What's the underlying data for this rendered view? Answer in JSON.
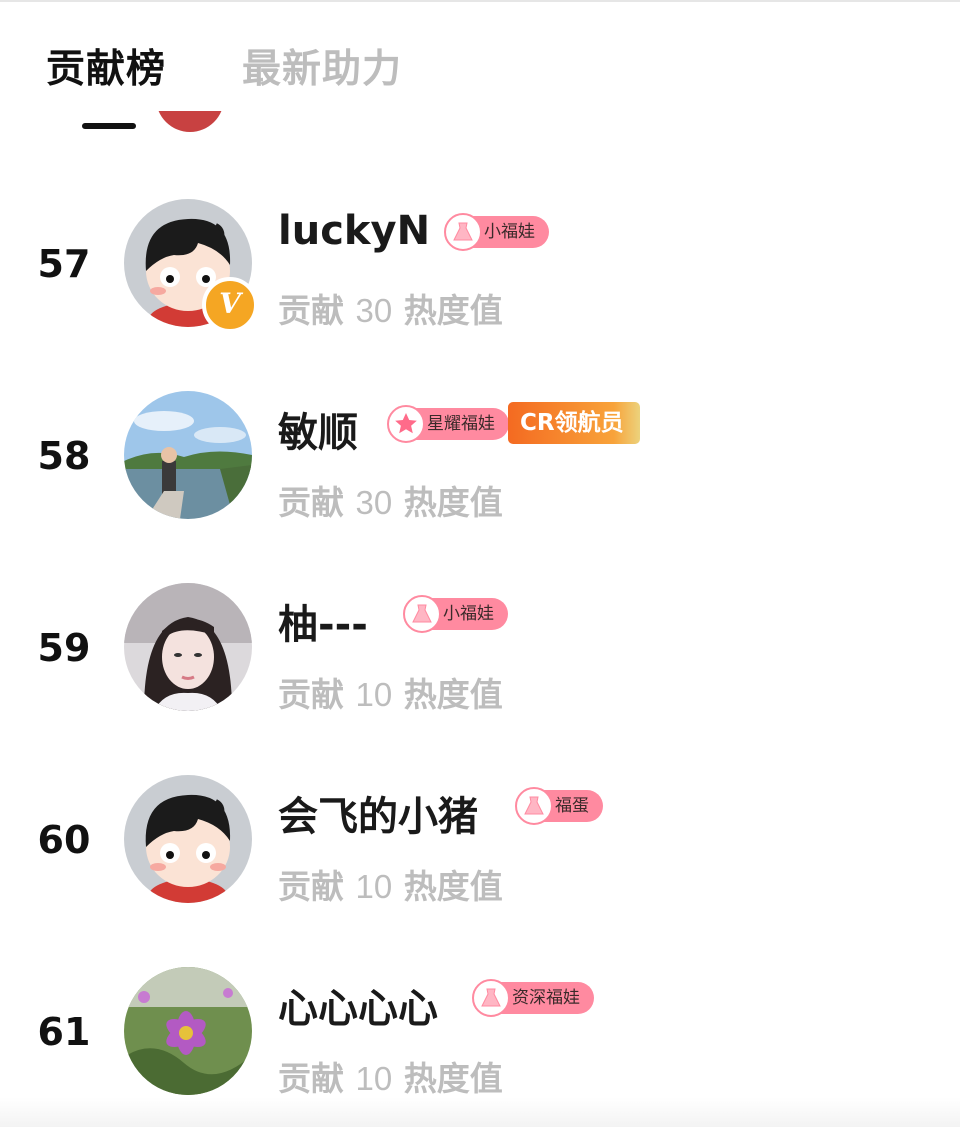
{
  "tabs": [
    {
      "label": "贡献榜",
      "active": true
    },
    {
      "label": "最新助力",
      "active": false
    }
  ],
  "colors": {
    "accent": "#111111",
    "muted_text": "#bdbdbd",
    "badge_pink": "#ff8aa0",
    "cr_badge_orange": "#f46a21",
    "verified_badge": "#f5a623"
  },
  "ranking": [
    {
      "rank": "57",
      "name": "luckyN",
      "badge": "小福娃",
      "badge_icon": "dress-icon",
      "verified": true,
      "verified_mark": "V",
      "contribution_prefix": "贡献",
      "contribution_value": "30",
      "contribution_suffix": "热度值"
    },
    {
      "rank": "58",
      "name": "敏顺",
      "badge": "星耀福娃",
      "badge_icon": "star-icon",
      "extra_badge": "CR领航员",
      "contribution_prefix": "贡献",
      "contribution_value": "30",
      "contribution_suffix": "热度值"
    },
    {
      "rank": "59",
      "name": "柚---",
      "badge": "小福娃",
      "badge_icon": "dress-icon",
      "contribution_prefix": "贡献",
      "contribution_value": "10",
      "contribution_suffix": "热度值"
    },
    {
      "rank": "60",
      "name": "会飞的小猪",
      "badge": "福蛋",
      "badge_icon": "dress-icon",
      "contribution_prefix": "贡献",
      "contribution_value": "10",
      "contribution_suffix": "热度值"
    },
    {
      "rank": "61",
      "name": "心心心心",
      "badge": "资深福娃",
      "badge_icon": "dress-icon",
      "contribution_prefix": "贡献",
      "contribution_value": "10",
      "contribution_suffix": "热度值"
    }
  ]
}
